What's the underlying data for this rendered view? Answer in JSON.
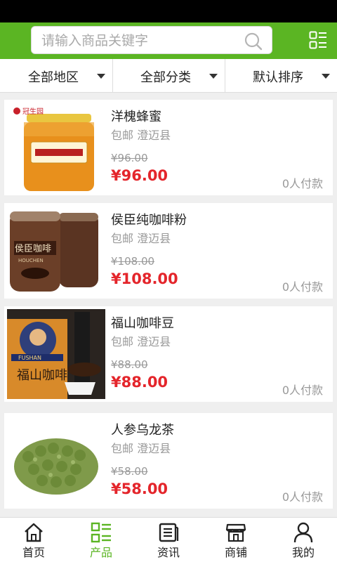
{
  "colors": {
    "brand": "#5bb523",
    "price": "#e4252b",
    "muted": "#999999"
  },
  "search": {
    "placeholder": "请输入商品关键字",
    "icon": "search-icon"
  },
  "header": {
    "menu_icon": "list-menu-icon"
  },
  "filters": [
    {
      "label": "全部地区"
    },
    {
      "label": "全部分类"
    },
    {
      "label": "默认排序"
    }
  ],
  "products": [
    {
      "name": "洋槐蜂蜜",
      "shipping": "包邮",
      "location": "澄迈县",
      "old_price": "¥96.00",
      "price": "¥96.00",
      "sold": "0人付款",
      "image": "honey-jar"
    },
    {
      "name": "侯臣纯咖啡粉",
      "shipping": "包邮",
      "location": "澄迈县",
      "old_price": "¥108.00",
      "price": "¥108.00",
      "sold": "0人付款",
      "image": "coffee-tins"
    },
    {
      "name": "福山咖啡豆",
      "shipping": "包邮",
      "location": "澄迈县",
      "old_price": "¥88.00",
      "price": "¥88.00",
      "sold": "0人付款",
      "image": "coffee-bean-bag"
    },
    {
      "name": "人参乌龙茶",
      "shipping": "包邮",
      "location": "澄迈县",
      "old_price": "¥58.00",
      "price": "¥58.00",
      "sold": "0人付款",
      "image": "oolong-tea"
    }
  ],
  "tabs": [
    {
      "label": "首页",
      "icon": "home-icon",
      "active": false
    },
    {
      "label": "产品",
      "icon": "product-list-icon",
      "active": true
    },
    {
      "label": "资讯",
      "icon": "news-icon",
      "active": false
    },
    {
      "label": "商铺",
      "icon": "store-icon",
      "active": false
    },
    {
      "label": "我的",
      "icon": "user-icon",
      "active": false
    }
  ],
  "image_marks": {
    "honey_label": "冠生园",
    "coffee_tin_label": "侯臣咖啡",
    "coffee_tin_sub": "HOUCHEN",
    "bean_bag_brand": "FUSHAN",
    "bean_bag_label": "福山咖啡"
  }
}
